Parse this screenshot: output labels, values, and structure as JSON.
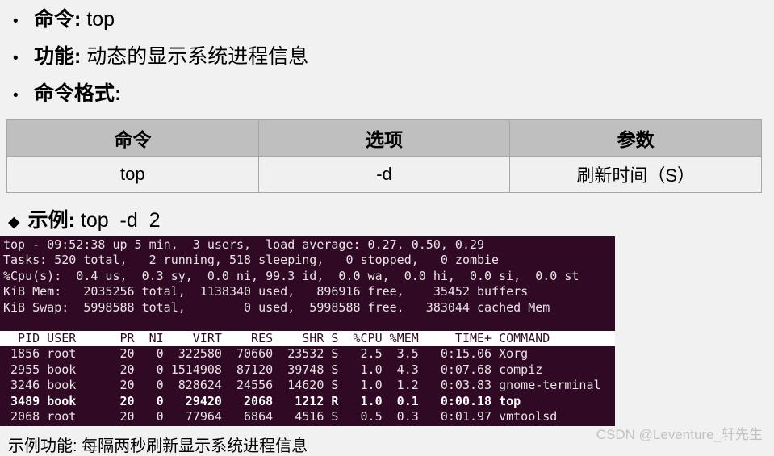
{
  "bullets": [
    {
      "marker": "•",
      "label": "命令:",
      "value": " top"
    },
    {
      "marker": "•",
      "label": "功能:",
      "value": " 动态的显示系统进程信息"
    },
    {
      "marker": "•",
      "label": "命令格式:",
      "value": ""
    }
  ],
  "table": {
    "headers": [
      "命令",
      "选项",
      "参数"
    ],
    "rows": [
      [
        "top",
        "-d",
        "刷新时间（S）"
      ]
    ]
  },
  "example": {
    "marker": "◆",
    "label": "示例:",
    "command": " top  -d  2"
  },
  "terminal": {
    "background_color": "#300a24",
    "text_color": "#e8e4e6",
    "header_bg_color": "#ffffff",
    "header_text_color": "#300a24",
    "summary_lines": [
      "top - 09:52:38 up 5 min,  3 users,  load average: 0.27, 0.50, 0.29",
      "Tasks: 520 total,   2 running, 518 sleeping,   0 stopped,   0 zombie",
      "%Cpu(s):  0.4 us,  0.3 sy,  0.0 ni, 99.3 id,  0.0 wa,  0.0 hi,  0.0 si,  0.0 st",
      "KiB Mem:   2035256 total,  1138340 used,   896916 free,    35452 buffers",
      "KiB Swap:  5998588 total,        0 used,  5998588 free.   383044 cached Mem"
    ],
    "process_header": "  PID USER      PR  NI    VIRT    RES    SHR S  %CPU %MEM     TIME+ COMMAND",
    "process_rows": [
      {
        "text": " 1856 root      20   0  322580  70660  23532 S   2.5  3.5   0:15.06 Xorg",
        "highlighted": false
      },
      {
        "text": " 2955 book      20   0 1514908  87120  39748 S   1.0  4.3   0:07.68 compiz",
        "highlighted": false
      },
      {
        "text": " 3246 book      20   0  828624  24556  14620 S   1.0  1.2   0:03.83 gnome-terminal",
        "highlighted": false
      },
      {
        "text": " 3489 book      20   0   29420   2068   1212 R   1.0  0.1   0:00.18 top",
        "highlighted": true
      },
      {
        "text": " 2068 root      20   0   77964   6864   4516 S   0.5  0.3   0:01.97 vmtoolsd",
        "highlighted": false
      }
    ]
  },
  "footer": {
    "note": "示例功能: 每隔两秒刷新显示系统进程信息",
    "watermark": "CSDN @Leventure_轩先生"
  }
}
